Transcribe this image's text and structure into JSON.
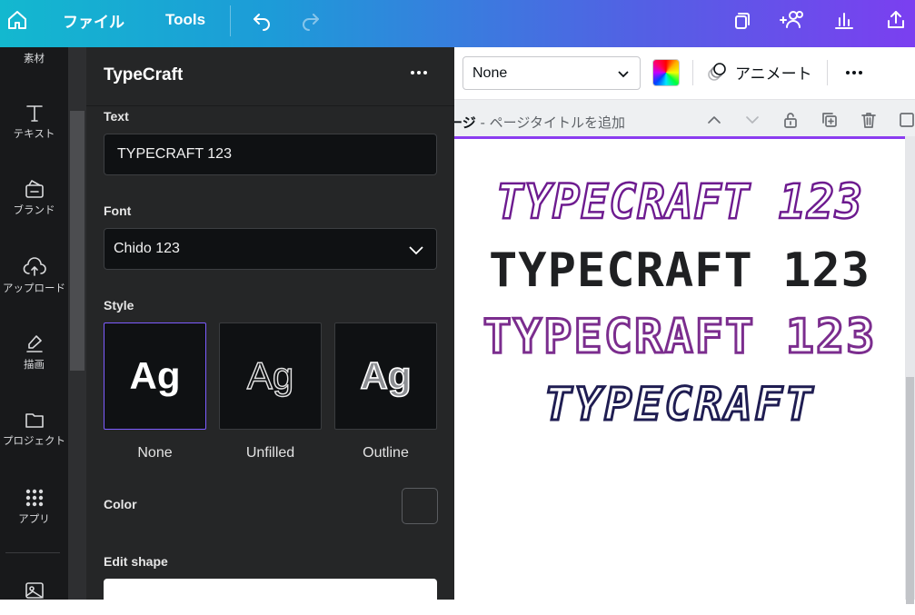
{
  "topbar": {
    "file_menu": "ファイル",
    "tools_menu": "Tools"
  },
  "rail": {
    "items": [
      {
        "label": "素材",
        "icon": "shapes-icon"
      },
      {
        "label": "テキスト",
        "icon": "text-icon"
      },
      {
        "label": "ブランド",
        "icon": "brand-icon"
      },
      {
        "label": "アップロード",
        "icon": "upload-icon"
      },
      {
        "label": "描画",
        "icon": "draw-icon"
      },
      {
        "label": "プロジェクト",
        "icon": "folder-icon"
      },
      {
        "label": "アプリ",
        "icon": "apps-icon"
      }
    ]
  },
  "panel": {
    "title": "TypeCraft",
    "text_section": "Text",
    "text_value": "TYPECRAFT 123",
    "font_section": "Font",
    "font_value": "Chido 123",
    "style_section": "Style",
    "styles": [
      {
        "preview": "Ag",
        "label": "None",
        "selected": true
      },
      {
        "preview": "Ag",
        "label": "Unfilled",
        "selected": false
      },
      {
        "preview": "Ag",
        "label": "Outline",
        "selected": false
      }
    ],
    "color_section": "Color",
    "edit_shape_section": "Edit shape"
  },
  "toolbar": {
    "effect_select": "None",
    "animate_label": "アニメート"
  },
  "page_header": {
    "page_label": "ージ",
    "separator": " - ",
    "title_placeholder": "ページタイトルを追加"
  },
  "canvas": {
    "word_arts": [
      "TYPECRAFT 123",
      "TYPECRAFT 123",
      "TYPECRAFT 123",
      "TYPECRAFT"
    ]
  },
  "colors": {
    "accent_purple": "#7d5cff",
    "page_border": "#8b3df0",
    "gradient_start": "#13b8cf",
    "gradient_end": "#7b3ff0"
  }
}
